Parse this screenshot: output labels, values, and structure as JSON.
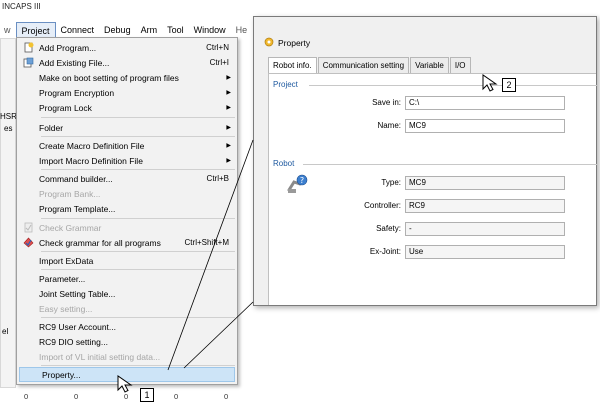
{
  "app": {
    "title": "INCAPS III"
  },
  "menubar": {
    "items": [
      {
        "label": "w"
      },
      {
        "label": "Project"
      },
      {
        "label": "Connect"
      },
      {
        "label": "Debug"
      },
      {
        "label": "Arm"
      },
      {
        "label": "Tool"
      },
      {
        "label": "Window"
      },
      {
        "label": "He"
      }
    ]
  },
  "bg_fragments": {
    "left_a": "HSR",
    "left_b": "es",
    "left_c": "el"
  },
  "project_menu": {
    "items": [
      {
        "label": "Add Program...",
        "shortcut": "Ctrl+N",
        "submenu": false,
        "disabled": false,
        "icon": "add-program-icon"
      },
      {
        "label": "Add Existing File...",
        "shortcut": "Ctrl+I",
        "submenu": false,
        "disabled": false,
        "icon": "add-existing-file-icon"
      },
      {
        "label": "Make on boot setting of program files",
        "shortcut": "",
        "submenu": true,
        "disabled": false,
        "icon": ""
      },
      {
        "label": "Program Encryption",
        "shortcut": "",
        "submenu": true,
        "disabled": false,
        "icon": ""
      },
      {
        "label": "Program Lock",
        "shortcut": "",
        "submenu": true,
        "disabled": false,
        "icon": ""
      },
      {
        "label": "Folder",
        "shortcut": "",
        "submenu": true,
        "disabled": false,
        "icon": ""
      },
      {
        "label": "Create Macro Definition File",
        "shortcut": "",
        "submenu": true,
        "disabled": false,
        "icon": ""
      },
      {
        "label": "Import Macro Definition File",
        "shortcut": "",
        "submenu": true,
        "disabled": false,
        "icon": ""
      },
      {
        "label": "Command builder...",
        "shortcut": "Ctrl+B",
        "submenu": false,
        "disabled": false,
        "icon": ""
      },
      {
        "label": "Program Bank...",
        "shortcut": "",
        "submenu": false,
        "disabled": true,
        "icon": ""
      },
      {
        "label": "Program Template...",
        "shortcut": "",
        "submenu": false,
        "disabled": false,
        "icon": ""
      },
      {
        "label": "Check Grammar",
        "shortcut": "",
        "submenu": false,
        "disabled": true,
        "icon": "check-grammar-icon"
      },
      {
        "label": "Check grammar for all programs",
        "shortcut": "Ctrl+Shift+M",
        "submenu": false,
        "disabled": false,
        "icon": "check-all-icon"
      },
      {
        "label": "Import ExData",
        "shortcut": "",
        "submenu": false,
        "disabled": false,
        "icon": ""
      },
      {
        "label": "Parameter...",
        "shortcut": "",
        "submenu": false,
        "disabled": false,
        "icon": ""
      },
      {
        "label": "Joint Setting Table...",
        "shortcut": "",
        "submenu": false,
        "disabled": false,
        "icon": ""
      },
      {
        "label": "Easy setting...",
        "shortcut": "",
        "submenu": false,
        "disabled": true,
        "icon": ""
      },
      {
        "label": "RC9 User Account...",
        "shortcut": "",
        "submenu": false,
        "disabled": false,
        "icon": ""
      },
      {
        "label": "RC9 DIO setting...",
        "shortcut": "",
        "submenu": false,
        "disabled": false,
        "icon": ""
      },
      {
        "label": "Import of VL initial setting data...",
        "shortcut": "",
        "submenu": false,
        "disabled": true,
        "icon": ""
      },
      {
        "label": "Property...",
        "shortcut": "",
        "submenu": false,
        "disabled": false,
        "icon": "",
        "highlighted": true
      }
    ]
  },
  "bottom_values": [
    "0",
    "0",
    "0",
    "0",
    "0"
  ],
  "property_dialog": {
    "title": "Property",
    "tabs": [
      "Robot info.",
      "Communication setting",
      "Variable",
      "I/O"
    ],
    "active_tab": "Robot info.",
    "project_group": "Project",
    "save_in_label": "Save in:",
    "save_in_value": "C:\\",
    "name_label": "Name:",
    "name_value": "MC9",
    "robot_group": "Robot",
    "type_label": "Type:",
    "type_value": "MC9",
    "controller_label": "Controller:",
    "controller_value": "RC9",
    "safety_label": "Safety:",
    "safety_value": "-",
    "exjoint_label": "Ex-Joint:",
    "exjoint_value": "Use"
  },
  "callouts": {
    "one": "1",
    "two": "2"
  },
  "colors": {
    "menu_highlight": "#cde4f7",
    "group_label": "#1f5aa0",
    "disabled_text": "#a6a6a6"
  }
}
